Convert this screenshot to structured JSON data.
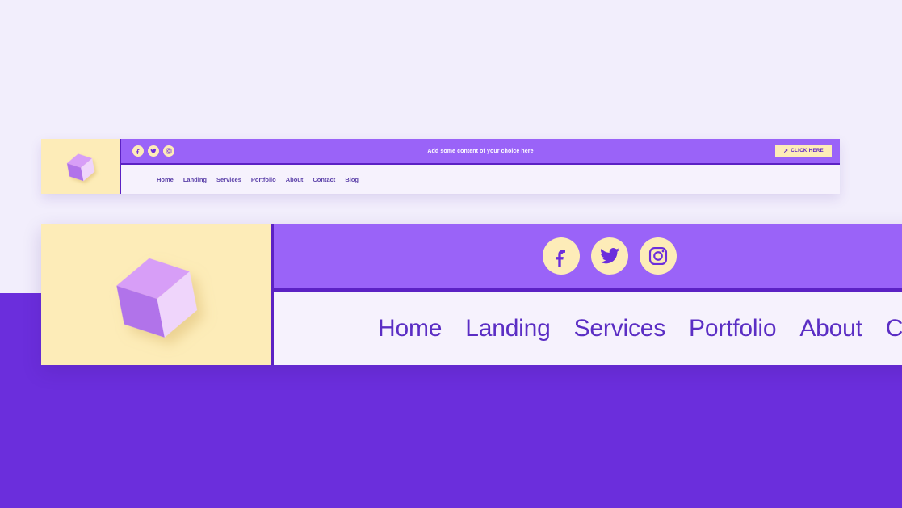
{
  "colors": {
    "page_background_top": "#f2eefc",
    "page_background_bottom": "#6b2edc",
    "card_background": "#f6f2fd",
    "logo_panel": "#fdecb8",
    "banner_purple": "#9a63f8",
    "border_purple": "#5c22c4",
    "nav_text": "#5b2ec4",
    "cta_text": "#5c22c4",
    "cube_top": "#d79ef7",
    "cube_left": "#b173ea",
    "cube_right": "#efd5fb"
  },
  "small_card": {
    "logo": {
      "icon": "cube-logo-icon"
    },
    "topbar": {
      "social": [
        {
          "name": "facebook-icon",
          "label": "Facebook"
        },
        {
          "name": "twitter-icon",
          "label": "Twitter"
        },
        {
          "name": "instagram-icon",
          "label": "Instagram"
        }
      ],
      "banner_text": "Add some content of your choice here",
      "cta": {
        "arrow": "↗",
        "label": "CLICK HERE"
      }
    },
    "nav": [
      {
        "label": "Home"
      },
      {
        "label": "Landing"
      },
      {
        "label": "Services"
      },
      {
        "label": "Portfolio"
      },
      {
        "label": "About"
      },
      {
        "label": "Contact"
      },
      {
        "label": "Blog"
      }
    ]
  },
  "large_card": {
    "logo": {
      "icon": "cube-logo-icon"
    },
    "topbar": {
      "social": [
        {
          "name": "facebook-icon",
          "label": "Facebook"
        },
        {
          "name": "twitter-icon",
          "label": "Twitter"
        },
        {
          "name": "instagram-icon",
          "label": "Instagram"
        }
      ]
    },
    "nav": [
      {
        "label": "Home"
      },
      {
        "label": "Landing"
      },
      {
        "label": "Services"
      },
      {
        "label": "Portfolio"
      },
      {
        "label": "About"
      },
      {
        "label": "Contact"
      }
    ]
  }
}
